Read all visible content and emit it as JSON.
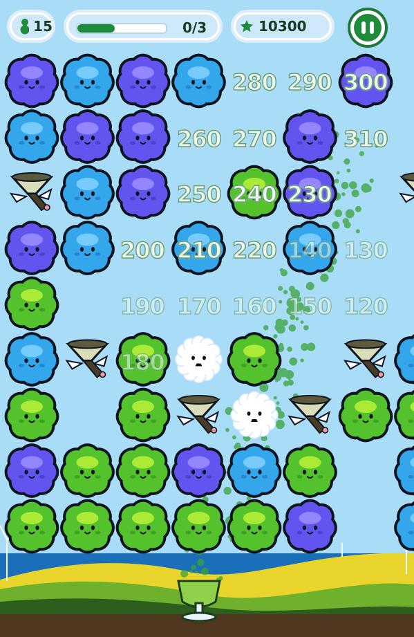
{
  "hud": {
    "moves_value": "15",
    "progress_text": "0/3",
    "progress_fraction": 0.42,
    "score_value": "10300"
  },
  "icons": {
    "moves": "lime-bottle-icon",
    "score": "star-icon",
    "pause": "pause-icon"
  },
  "colors": {
    "sky": "#a9dcf6",
    "green_blob": "#54c22c",
    "blue_blob": "#34a6ec",
    "purple_blob": "#6254ee",
    "hud_green": "#1f8b3c"
  },
  "floating_scores": [
    "280",
    "290",
    "300",
    "260",
    "270",
    "310",
    "250",
    "240",
    "230",
    "200",
    "210",
    "220",
    "140",
    "130",
    "190",
    "170",
    "160",
    "150",
    "120",
    "180"
  ],
  "board": [
    [
      "purple",
      "blue",
      "purple",
      "blue",
      "",
      "",
      "purple",
      ""
    ],
    [
      "blue",
      "purple",
      "purple",
      "",
      "",
      "purple",
      "",
      ""
    ],
    [
      "funnel",
      "blue",
      "purple",
      "",
      "green",
      "purple",
      "",
      "funnel"
    ],
    [
      "purple",
      "blue",
      "",
      "blue",
      "",
      "blue",
      "",
      ""
    ],
    [
      "green",
      "",
      "",
      "",
      "",
      "",
      "",
      ""
    ],
    [
      "blue",
      "funnel",
      "green",
      "ice",
      "green",
      "",
      "funnel",
      "blue"
    ],
    [
      "green",
      "",
      "green",
      "funnel",
      "ice",
      "funnel",
      "green",
      "green"
    ],
    [
      "purple",
      "green",
      "green",
      "purple",
      "blue",
      "green",
      "",
      "blue"
    ],
    [
      "green",
      "green",
      "green",
      "green",
      "green",
      "purple",
      "",
      "blue"
    ]
  ],
  "legend": {
    "green": "green-blob",
    "blue": "blue-blob",
    "purple": "purple-blob",
    "funnel": "funnel-bird",
    "ice": "snowflake-blob"
  }
}
